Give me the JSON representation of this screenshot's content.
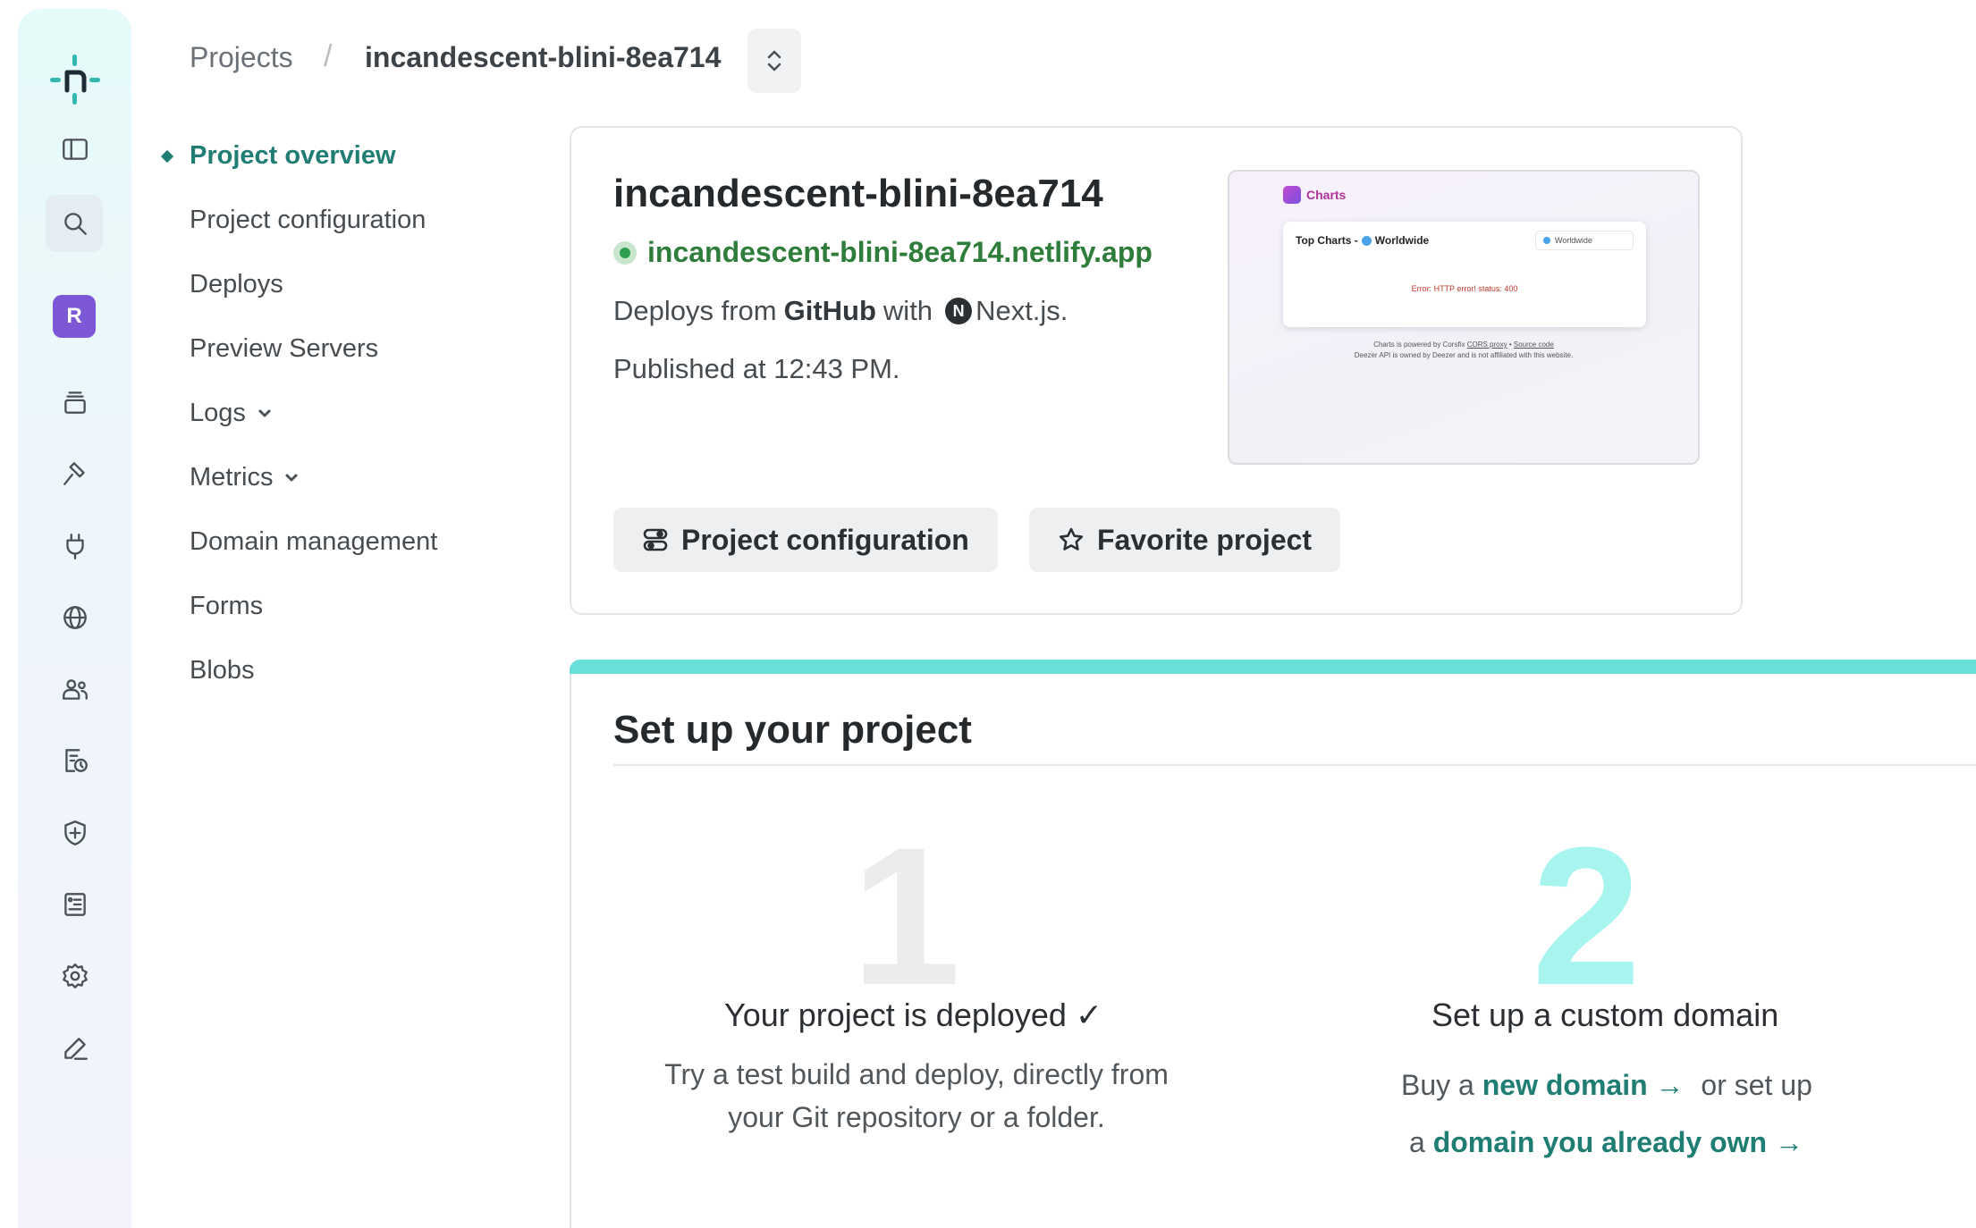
{
  "breadcrumb": {
    "root": "Projects",
    "separator": "/",
    "current": "incandescent-blini-8ea714"
  },
  "sidebar": {
    "avatar_initial": "R",
    "icons": [
      "logo-icon",
      "sidebar-toggle-icon",
      "search-icon",
      "team-avatar",
      "projects-icon",
      "builds-icon",
      "extensions-icon",
      "domains-icon",
      "members-icon",
      "audit-log-icon",
      "security-icon",
      "billing-icon",
      "settings-icon",
      "edit-icon"
    ]
  },
  "subnav": {
    "items": [
      {
        "label": "Project overview",
        "active": true
      },
      {
        "label": "Project configuration"
      },
      {
        "label": "Deploys"
      },
      {
        "label": "Preview Servers"
      },
      {
        "label": "Logs",
        "expandable": true
      },
      {
        "label": "Metrics",
        "expandable": true
      },
      {
        "label": "Domain management"
      },
      {
        "label": "Forms"
      },
      {
        "label": "Blobs"
      }
    ]
  },
  "project": {
    "name": "incandescent-blini-8ea714",
    "url": "incandescent-blini-8ea714.netlify.app",
    "deploys_prefix": "Deploys from",
    "deploys_source": "GitHub",
    "deploys_with": "with",
    "framework": "Next.js.",
    "framework_badge": "N",
    "published": "Published at 12:43 PM.",
    "buttons": {
      "configuration": "Project configuration",
      "favorite": "Favorite project"
    }
  },
  "preview": {
    "brand": "Charts",
    "panel_title_prefix": "Top Charts -",
    "panel_title_region": "Worldwide",
    "select_value": "Worldwide",
    "error_text": "Error: HTTP error! status: 400",
    "footer_line1_prefix": "Charts is powered by Corsfix",
    "footer_link1": "CORS proxy",
    "footer_dot": "•",
    "footer_link2": "Source code",
    "footer_line2": "Deezer API is owned by Deezer and is not affiliated with this website."
  },
  "setup": {
    "title": "Set up your project",
    "step1": {
      "number": "1",
      "title": "Your project is deployed ✓",
      "description": "Try a test build and deploy, directly from your Git repository or a folder."
    },
    "step2": {
      "number": "2",
      "title": "Set up a custom domain",
      "line1_prefix": "Buy a",
      "link1": "new domain →",
      "line1_suffix": "or set up",
      "line2_prefix": "a",
      "link2": "domain you already own →"
    }
  },
  "colors": {
    "accent": "#1f7d74",
    "url_green": "#2f7d3a",
    "setup_bar": "#69dfd9",
    "avatar": "#7c57d6"
  }
}
